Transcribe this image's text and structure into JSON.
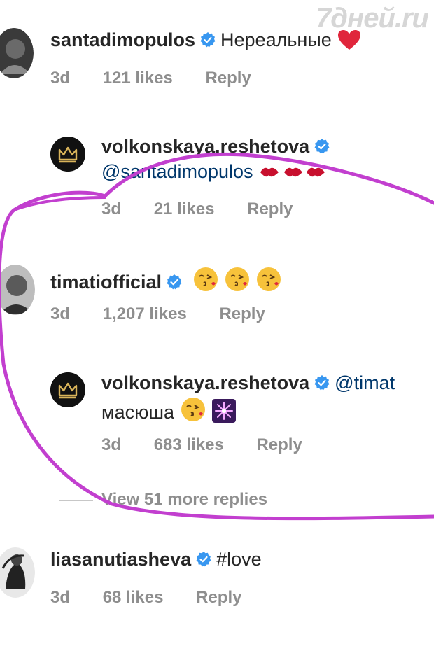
{
  "watermark": "7дней.ru",
  "comments": [
    {
      "username": "santadimopulos",
      "text": "Нереальные",
      "emoji": "red-heart",
      "time": "3d",
      "likes": "121 likes",
      "reply": "Reply"
    },
    {
      "username": "volkonskaya.reshetova",
      "mention": "@santadimopulos",
      "emoji": "kiss-mark",
      "time": "3d",
      "likes": "21 likes",
      "reply": "Reply"
    },
    {
      "username": "timatiofficial",
      "emoji": "face-blowing-kiss",
      "time": "3d",
      "likes": "1,207 likes",
      "reply": "Reply"
    },
    {
      "username": "volkonskaya.reshetova",
      "mention": "@timat",
      "text2": "масюша",
      "emoji": "face-blowing-kiss, sparkler",
      "time": "3d",
      "likes": "683 likes",
      "reply": "Reply"
    },
    {
      "username": "liasanutiasheva",
      "text": "#love",
      "time": "3d",
      "likes": "68 likes",
      "reply": "Reply"
    }
  ],
  "view_more": "View 51 more replies",
  "colors": {
    "verified": "#3897f0",
    "muted": "#8e8e8e",
    "annotation": "#c23fcf"
  }
}
